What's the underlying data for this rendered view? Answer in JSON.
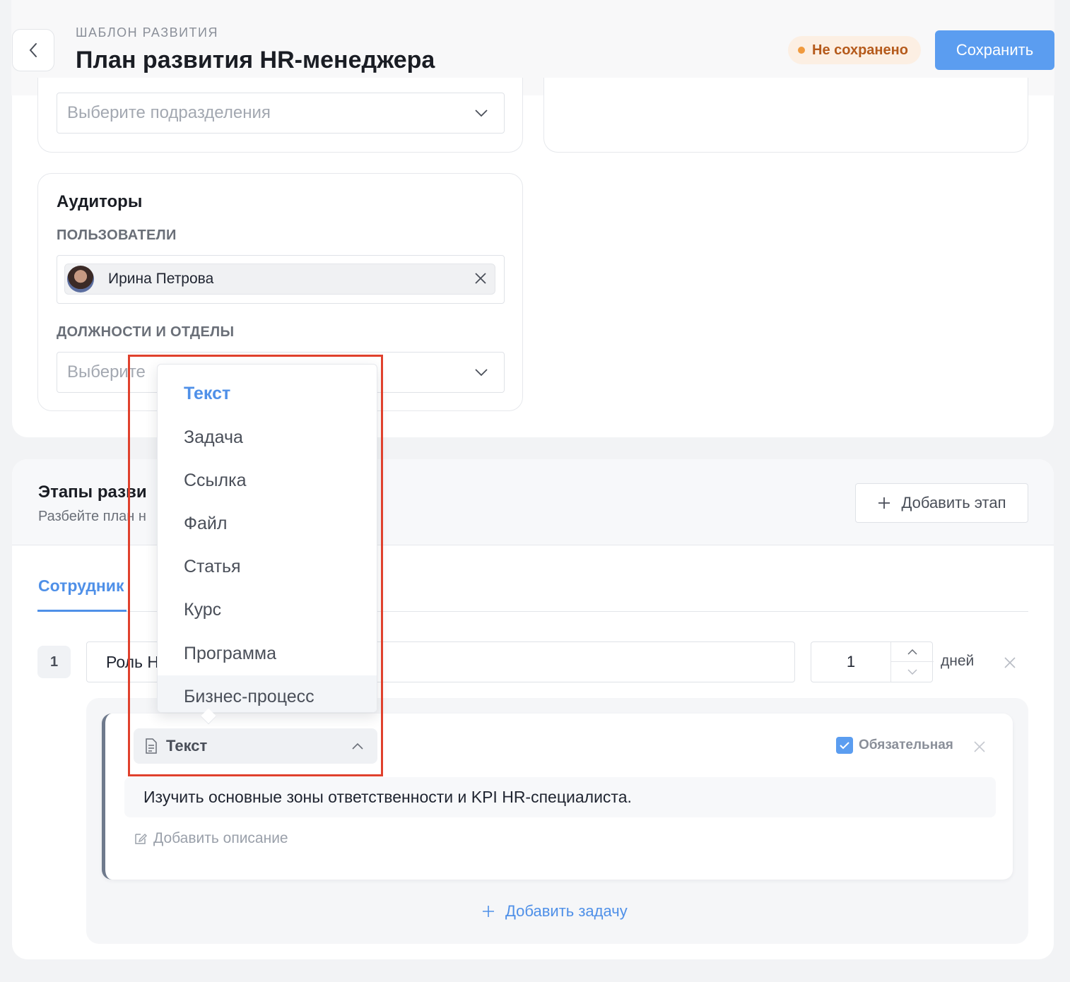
{
  "header": {
    "eyebrow": "ШАБЛОН РАЗВИТИЯ",
    "title": "План развития HR-менеджера",
    "status": "Не сохранено",
    "save_label": "Сохранить",
    "colors": {
      "accent": "#5b9df0",
      "status_text": "#b55a1b",
      "status_bg": "#fcefe3",
      "status_dot": "#f09a3e"
    }
  },
  "departments": {
    "placeholder": "Выберите подразделения"
  },
  "auditors": {
    "title": "Аудиторы",
    "users_label": "ПОЛЬЗОВАТЕЛИ",
    "user_chip": {
      "name": "Ирина Петрова",
      "icon": "avatar"
    },
    "positions_label": "ДОЛЖНОСТИ И ОТДЕЛЫ",
    "positions_placeholder": "Выберите"
  },
  "stages": {
    "title": "Этапы разви",
    "subtitle": "Разбейте план н",
    "add_stage_label": "Добавить этап",
    "tab_active": "Сотрудник",
    "stage": {
      "number": "1",
      "name": "Роль Н",
      "days_value": "1",
      "days_label": "дней"
    },
    "task": {
      "type_label": "Текст",
      "mandatory_label": "Обязательная",
      "mandatory_checked": true,
      "text": "Изучить основные зоны ответственности и KPI HR-специалиста.",
      "add_description_label": "Добавить описание"
    },
    "add_task_label": "Добавить задачу"
  },
  "type_dropdown": {
    "selected": "Текст",
    "options": [
      "Текст",
      "Задача",
      "Ссылка",
      "Файл",
      "Статья",
      "Курс",
      "Программа",
      "Бизнес-процесс"
    ]
  },
  "annotation": {
    "highlight_color": "#e0412d"
  }
}
